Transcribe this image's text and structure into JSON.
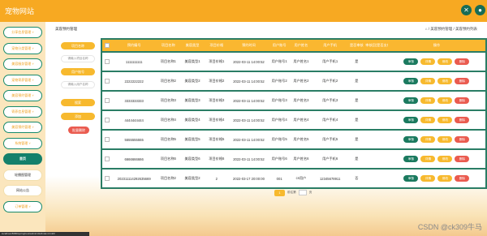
{
  "app": {
    "title": "宠物网站"
  },
  "sidebar": {
    "items": [
      {
        "label": "分享信息管理 ˅",
        "style": "normal"
      },
      {
        "label": "宠物分类管理 ˅",
        "style": "normal"
      },
      {
        "label": "美容服务管理 ˅",
        "style": "normal"
      },
      {
        "label": "宠物寄养管理 ˅",
        "style": "normal"
      },
      {
        "label": "美容预约管理 ˅",
        "style": "normal"
      },
      {
        "label": "寄养信息管理 ˅",
        "style": "normal"
      },
      {
        "label": "美容预约管理 ˅",
        "style": "normal"
      },
      {
        "label": "系统管理 ˅",
        "style": "normal"
      },
      {
        "label": "首页",
        "style": "active"
      },
      {
        "label": "轮播图管理",
        "style": "plain"
      },
      {
        "label": "网站公告",
        "style": "plain"
      },
      {
        "label": "订单管理 ˅",
        "style": "normal"
      }
    ]
  },
  "page": {
    "title": "美容预约管理",
    "breadcrumb": "⌂ / 美容预约管理 / 美容预约列表"
  },
  "filters": {
    "btn1": "项目名称",
    "input1_placeholder": "请输入项目名称",
    "btn2": "用户账号",
    "input2_placeholder": "请输入用户名称",
    "search": "搜索",
    "add": "添加",
    "batch_delete": "批量删除"
  },
  "table": {
    "headers": [
      "预约编号",
      "项目名称",
      "美容类型",
      "项目价格",
      "预约时间",
      "用户账号",
      "用户姓名",
      "用户手机",
      "是否审核",
      "审核回复",
      "是否支付",
      "操作"
    ],
    "actions": [
      "审核",
      "详情",
      "修改",
      "删除"
    ],
    "rows": [
      [
        "1111111111",
        "项目名称1",
        "美容类型1",
        "项目价格1",
        "2022-03-11 14:00:52",
        "用户账号1",
        "用户姓名1",
        "用户手机1",
        "是",
        "",
        ""
      ],
      [
        "2222222222",
        "项目名称2",
        "美容类型2",
        "项目价格2",
        "2022-03-11 14:00:52",
        "用户账号2",
        "用户姓名2",
        "用户手机2",
        "是",
        "",
        ""
      ],
      [
        "3333333333",
        "项目名称3",
        "美容类型3",
        "项目价格3",
        "2022-03-11 14:00:52",
        "用户账号3",
        "用户姓名3",
        "用户手机3",
        "是",
        "",
        ""
      ],
      [
        "4444444444",
        "项目名称4",
        "美容类型4",
        "项目价格4",
        "2022-03-11 14:00:52",
        "用户账号4",
        "用户姓名4",
        "用户手机4",
        "是",
        "",
        ""
      ],
      [
        "5555555555",
        "项目名称5",
        "美容类型5",
        "项目价格5",
        "2022-03-11 14:00:52",
        "用户账号5",
        "用户姓名5",
        "用户手机5",
        "是",
        "",
        ""
      ],
      [
        "6666666666",
        "项目名称6",
        "美容类型6",
        "项目价格6",
        "2022-03-11 14:00:52",
        "用户账号6",
        "用户姓名6",
        "用户手机6",
        "是",
        "",
        ""
      ],
      [
        "202311114292635669",
        "项目名称2",
        "美容类型2",
        "2",
        "2022-03-17 20:00:00",
        "001",
        "cs用户",
        "12345678911",
        "否",
        "",
        ""
      ]
    ]
  },
  "pager": {
    "page": "1",
    "goto": "前往第",
    "unit": "页"
  },
  "status_url": "localhost:8080/springboot/admin/dist/index.html#/",
  "watermark": "CSDN @ck309牛马"
}
